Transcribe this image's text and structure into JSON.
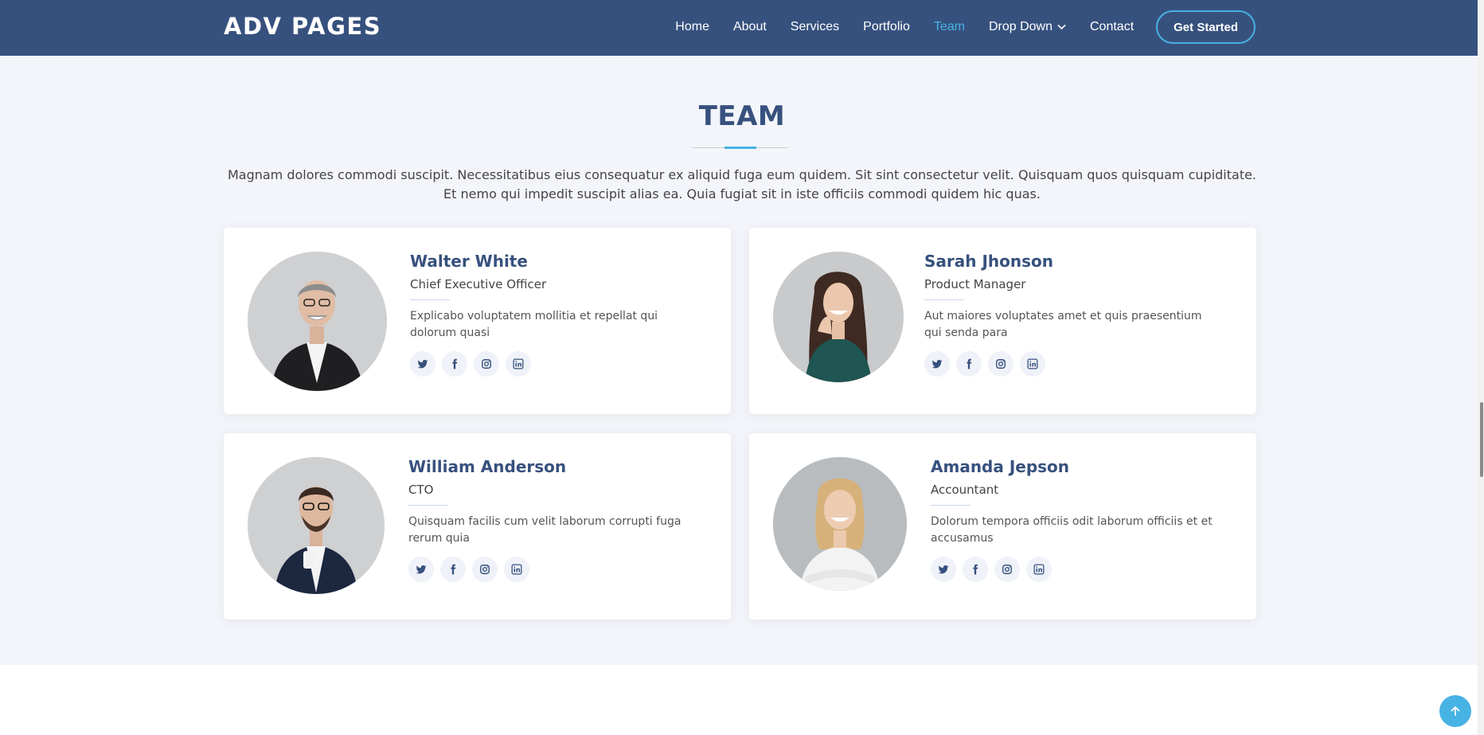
{
  "header": {
    "logo": "ADV PAGES",
    "nav": [
      "Home",
      "About",
      "Services",
      "Portfolio",
      "Team",
      "Drop Down",
      "Contact"
    ],
    "active": "Team",
    "cta": "Get Started"
  },
  "section": {
    "title": "TEAM",
    "description": "Magnam dolores commodi suscipit. Necessitatibus eius consequatur ex aliquid fuga eum quidem. Sit sint consectetur velit. Quisquam quos quisquam cupiditate. Et nemo qui impedit suscipit alias ea. Quia fugiat sit in iste officiis commodi quidem hic quas."
  },
  "team": [
    {
      "name": "Walter White",
      "role": "Chief Executive Officer",
      "bio": "Explicabo voluptatem mollitia et repellat qui dolorum quasi"
    },
    {
      "name": "Sarah Jhonson",
      "role": "Product Manager",
      "bio": "Aut maiores voluptates amet et quis praesentium qui senda para"
    },
    {
      "name": "William Anderson",
      "role": "CTO",
      "bio": "Quisquam facilis cum velit laborum corrupti fuga rerum quia"
    },
    {
      "name": "Amanda Jepson",
      "role": "Accountant",
      "bio": "Dolorum tempora officiis odit laborum officiis et et accusamus"
    }
  ],
  "social_icons": [
    "twitter-icon",
    "facebook-icon",
    "instagram-icon",
    "linkedin-icon"
  ],
  "colors": {
    "primary": "#37517e",
    "accent": "#47b2e4",
    "background": "#f3f5fa"
  }
}
